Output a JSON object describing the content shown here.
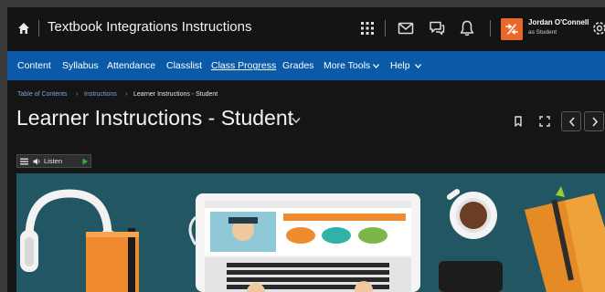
{
  "header": {
    "course_title": "Textbook Integrations Instructions",
    "user_name": "Jordan O'Connell",
    "user_role": "as Student",
    "accent": "#e8692a"
  },
  "nav": {
    "items": [
      "Content",
      "Syllabus",
      "Attendance",
      "Classlist",
      "Class Progress",
      "Grades",
      "More Tools",
      "Help"
    ],
    "active": "Class Progress",
    "background": "#0b5aa8"
  },
  "breadcrumb": {
    "items": [
      "Table of Contents",
      "Instructions",
      "Learner Instructions - Student"
    ]
  },
  "page": {
    "title": "Learner Instructions - Student"
  },
  "listen": {
    "label": "Listen"
  },
  "icons": {
    "home": "home-icon",
    "apps": "grid-icon",
    "mail": "mail-icon",
    "chat": "chat-icon",
    "alerts": "bell-icon",
    "settings": "gear-icon",
    "bookmark": "bookmark-icon",
    "fullscreen": "fullscreen-icon",
    "previous": "chevron-left-icon",
    "next": "chevron-right-icon"
  }
}
